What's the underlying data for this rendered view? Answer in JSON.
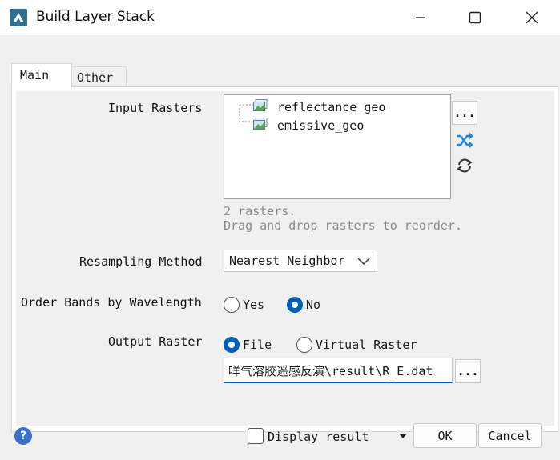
{
  "window": {
    "title": "Build Layer Stack",
    "minimize_glyph": "—",
    "maximize_glyph": "☐",
    "close_glyph": "✕"
  },
  "tabs": [
    {
      "label": "Main",
      "active": true
    },
    {
      "label": "Other",
      "active": false
    }
  ],
  "main": {
    "input_rasters": {
      "label": "Input Rasters",
      "items": [
        "reflectance_geo",
        "emissive_geo"
      ],
      "browse_label": "...",
      "count_text": "2 rasters.",
      "hint_text": "Drag and drop rasters to reorder."
    },
    "resampling": {
      "label": "Resampling Method",
      "value": "Nearest Neighbor"
    },
    "order_bands": {
      "label": "Order Bands by Wavelength",
      "options": [
        "Yes",
        "No"
      ],
      "selected": "No"
    },
    "output_raster": {
      "label": "Output Raster",
      "options": [
        "File",
        "Virtual Raster"
      ],
      "selected": "File",
      "value": "咩气溶胶遥感反演\\result\\R_E.dat",
      "browse_label": "..."
    }
  },
  "footer": {
    "help_glyph": "?",
    "display_result_label": "Display result",
    "display_result_checked": false,
    "ok_label": "OK",
    "cancel_label": "Cancel"
  },
  "colors": {
    "accent": "#005fb8",
    "shuffle_icon": "#1e88e5",
    "help_icon": "#3b6fd0"
  }
}
